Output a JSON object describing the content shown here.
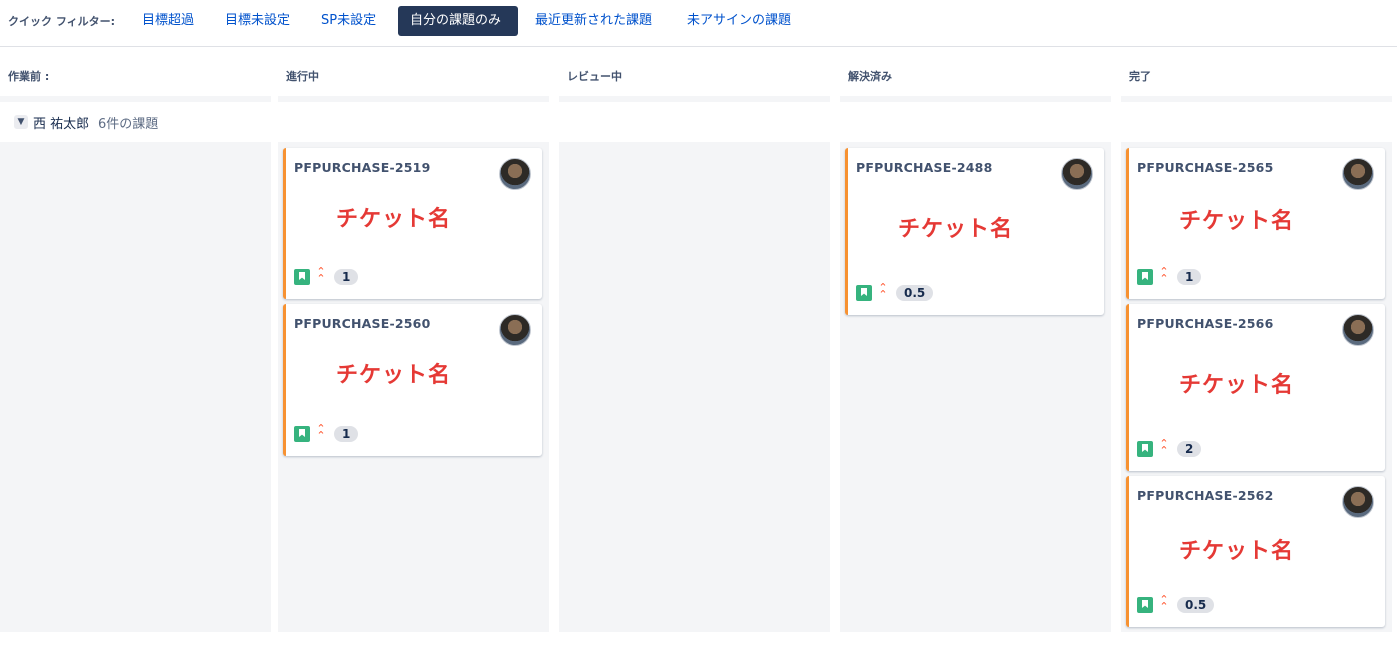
{
  "quick_filters": {
    "label": "クイック フィルター:",
    "items": [
      "目標超過",
      "目標未設定",
      "SP未設定",
      "自分の課題のみ",
      "最近更新された課題",
      "未アサインの課題"
    ],
    "active_index": 3
  },
  "columns": [
    {
      "title": "作業前 :"
    },
    {
      "title": "進行中"
    },
    {
      "title": "レビュー中"
    },
    {
      "title": "解決済み"
    },
    {
      "title": "完了"
    }
  ],
  "swimlane": {
    "assignee": "西 祐太郎",
    "issue_count": "6件の課題"
  },
  "cards": {
    "c2519": {
      "key": "PFPURCHASE-2519",
      "summary": "チケット名",
      "story_points": "1"
    },
    "c2560": {
      "key": "PFPURCHASE-2560",
      "summary": "チケット名",
      "story_points": "1"
    },
    "c2488": {
      "key": "PFPURCHASE-2488",
      "summary": "チケット名",
      "story_points": "0.5"
    },
    "c2565": {
      "key": "PFPURCHASE-2565",
      "summary": "チケット名",
      "story_points": "1"
    },
    "c2566": {
      "key": "PFPURCHASE-2566",
      "summary": "チケット名",
      "story_points": "2"
    },
    "c2562": {
      "key": "PFPURCHASE-2562",
      "summary": "チケット名",
      "story_points": "0.5"
    }
  },
  "icons": {
    "issue_type": "story-icon",
    "priority": "priority-highest-icon",
    "expand": "chevron-down-icon"
  },
  "colors": {
    "accent": "#0052cc",
    "active_filter_bg": "#253858",
    "card_border": "#f79232",
    "story_icon": "#36b37e",
    "priority": "#ff5630",
    "summary_text": "#e53935"
  }
}
